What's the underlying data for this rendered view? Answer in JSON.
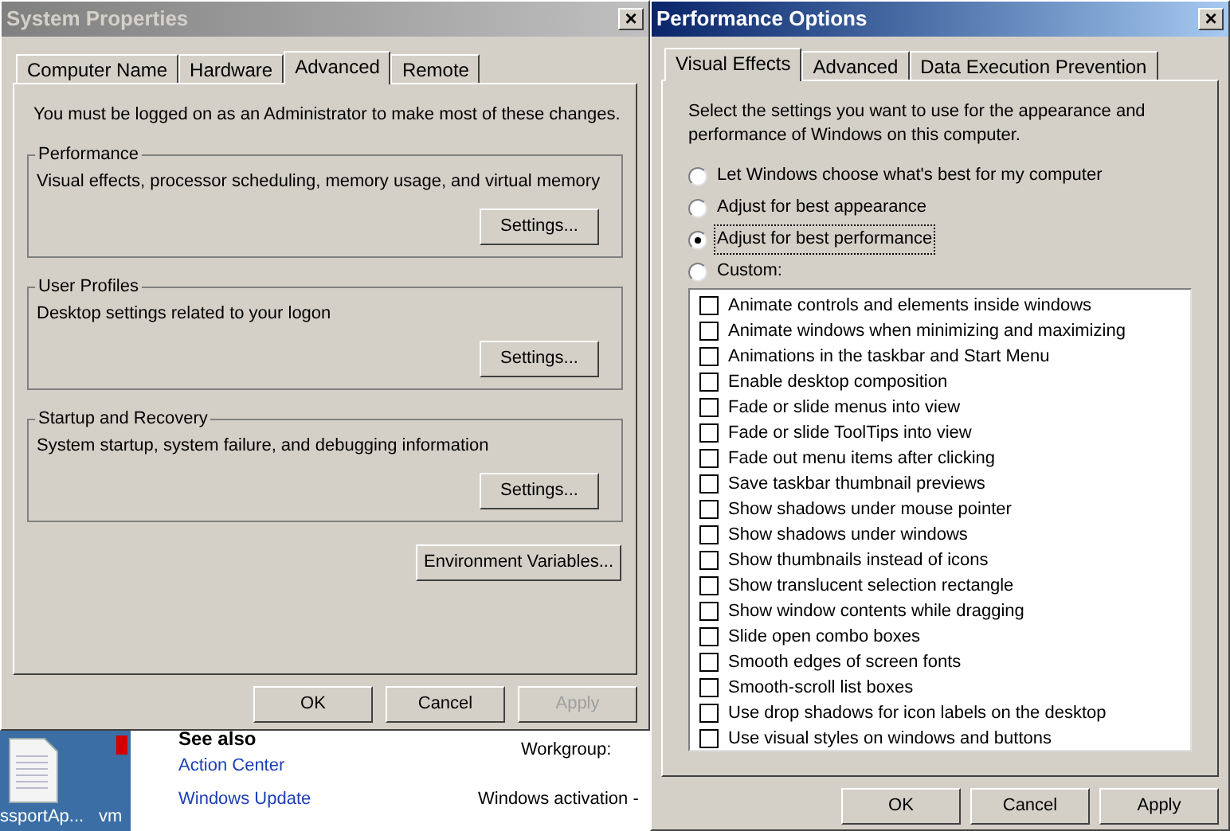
{
  "system_properties": {
    "title": "System Properties",
    "close": "×",
    "tabs": [
      {
        "label": "Computer Name",
        "selected": false
      },
      {
        "label": "Hardware",
        "selected": false
      },
      {
        "label": "Advanced",
        "selected": true
      },
      {
        "label": "Remote",
        "selected": false
      }
    ],
    "notice": "You must be logged on as an Administrator to make most of these changes.",
    "groups": [
      {
        "title": "Performance",
        "description": "Visual effects, processor scheduling, memory usage, and virtual memory",
        "button": "Settings..."
      },
      {
        "title": "User Profiles",
        "description": "Desktop settings related to your logon",
        "button": "Settings..."
      },
      {
        "title": "Startup and Recovery",
        "description": "System startup, system failure, and debugging information",
        "button": "Settings..."
      }
    ],
    "environment_button": "Environment Variables...",
    "buttons": [
      {
        "label": "OK",
        "disabled": false
      },
      {
        "label": "Cancel",
        "disabled": false
      },
      {
        "label": "Apply",
        "disabled": true
      }
    ]
  },
  "background": {
    "desktop_icons": [
      "ssportAp...",
      "vm"
    ],
    "see_also": "See also",
    "links": [
      "Action Center",
      "Windows Update"
    ],
    "labels": [
      "Workgroup:",
      "Windows activation -"
    ]
  },
  "performance_options": {
    "title": "Performance Options",
    "close": "×",
    "tabs": [
      {
        "label": "Visual Effects",
        "selected": true
      },
      {
        "label": "Advanced",
        "selected": false
      },
      {
        "label": "Data Execution Prevention",
        "selected": false
      }
    ],
    "intro": "Select the settings you want to use for the appearance and performance of Windows on this computer.",
    "radios": [
      {
        "label": "Let Windows choose what's best for my computer",
        "selected": false
      },
      {
        "label": "Adjust for best appearance",
        "selected": false
      },
      {
        "label": "Adjust for best performance",
        "selected": true
      },
      {
        "label": "Custom:",
        "selected": false
      }
    ],
    "effects": [
      {
        "label": "Animate controls and elements inside windows",
        "checked": false
      },
      {
        "label": "Animate windows when minimizing and maximizing",
        "checked": false
      },
      {
        "label": "Animations in the taskbar and Start Menu",
        "checked": false
      },
      {
        "label": "Enable desktop composition",
        "checked": false
      },
      {
        "label": "Fade or slide menus into view",
        "checked": false
      },
      {
        "label": "Fade or slide ToolTips into view",
        "checked": false
      },
      {
        "label": "Fade out menu items after clicking",
        "checked": false
      },
      {
        "label": "Save taskbar thumbnail previews",
        "checked": false
      },
      {
        "label": "Show shadows under mouse pointer",
        "checked": false
      },
      {
        "label": "Show shadows under windows",
        "checked": false
      },
      {
        "label": "Show thumbnails instead of icons",
        "checked": false
      },
      {
        "label": "Show translucent selection rectangle",
        "checked": false
      },
      {
        "label": "Show window contents while dragging",
        "checked": false
      },
      {
        "label": "Slide open combo boxes",
        "checked": false
      },
      {
        "label": "Smooth edges of screen fonts",
        "checked": false
      },
      {
        "label": "Smooth-scroll list boxes",
        "checked": false
      },
      {
        "label": "Use drop shadows for icon labels on the desktop",
        "checked": false
      },
      {
        "label": "Use visual styles on windows and buttons",
        "checked": false
      }
    ],
    "buttons": [
      {
        "label": "OK",
        "disabled": false
      },
      {
        "label": "Cancel",
        "disabled": false
      },
      {
        "label": "Apply",
        "disabled": false
      }
    ]
  }
}
